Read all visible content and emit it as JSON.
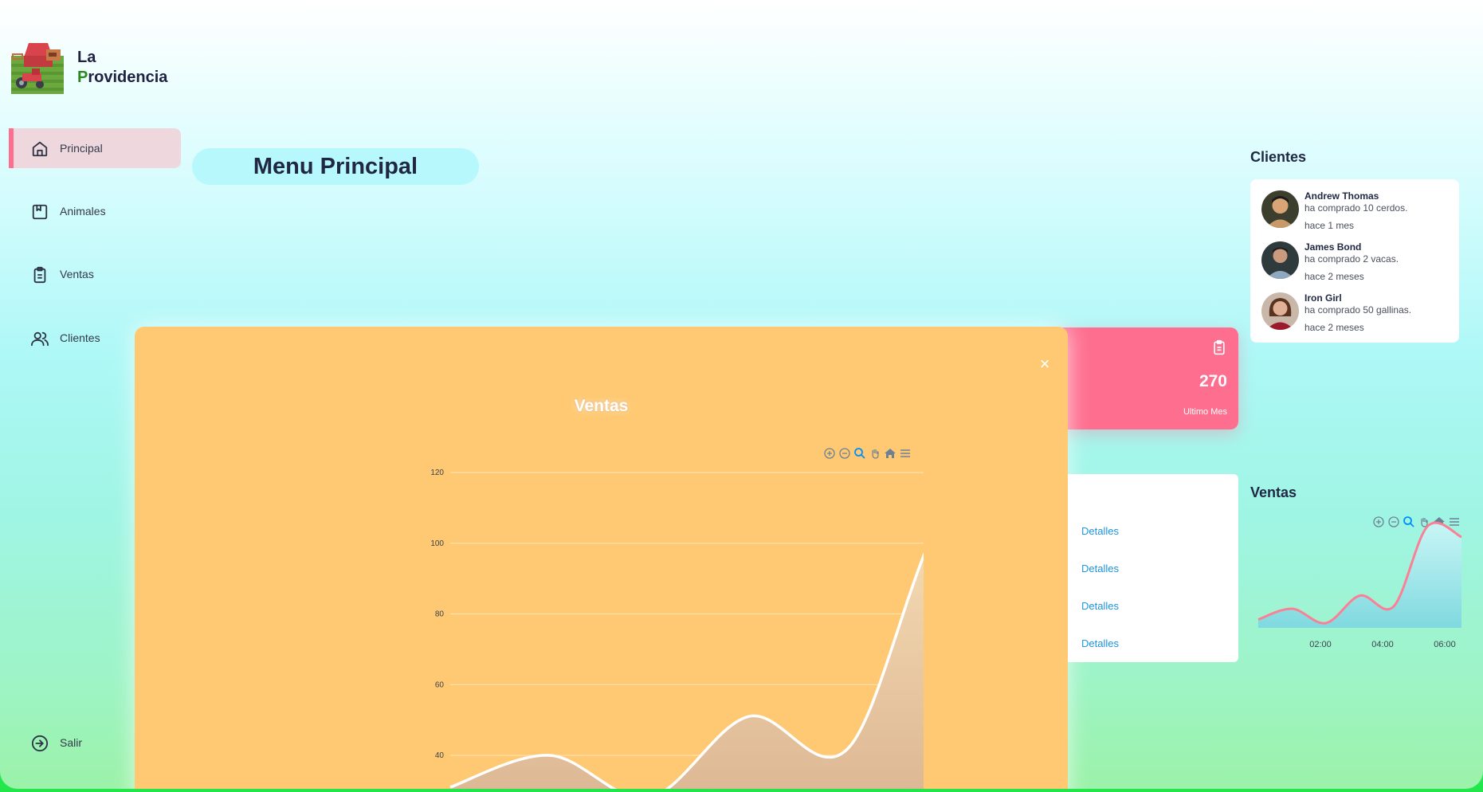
{
  "brand": {
    "line1": "La",
    "initial": "P",
    "rest": "rovidencia"
  },
  "sidebar": {
    "items": [
      {
        "label": "Principal",
        "icon": "home-icon",
        "active": true
      },
      {
        "label": "Animales",
        "icon": "bookmark-box-icon"
      },
      {
        "label": "Ventas",
        "icon": "clipboard-icon"
      },
      {
        "label": "Clientes",
        "icon": "users-icon"
      }
    ],
    "logout": {
      "label": "Salir",
      "icon": "logout-icon"
    }
  },
  "header": {
    "title": "Menu Principal"
  },
  "clients": {
    "title": "Clientes",
    "items": [
      {
        "name": "Andrew Thomas",
        "desc": "ha comprado 10 cerdos.",
        "time": "hace 1 mes"
      },
      {
        "name": "James Bond",
        "desc": "ha comprado 2 vacas.",
        "time": "hace 2 meses"
      },
      {
        "name": "Iron Girl",
        "desc": "ha comprado 50 gallinas.",
        "time": "hace 2 meses"
      }
    ]
  },
  "stat": {
    "value": "270",
    "label": "Ultimo Mes",
    "icon": "clipboard-icon",
    "color": "#fe6e8f"
  },
  "orders": {
    "links": [
      "Detalles",
      "Detalles",
      "Detalles",
      "Detalles"
    ]
  },
  "mini_sales": {
    "title": "Ventas",
    "x_ticks": [
      "02:00",
      "04:00",
      "06:00"
    ]
  },
  "modal": {
    "title": "Ventas",
    "close": "×"
  },
  "chart_data": [
    {
      "type": "area",
      "title": "Ventas",
      "y_ticks": [
        40,
        60,
        80,
        100,
        120
      ],
      "ylim": [
        24,
        120
      ],
      "x": [
        0,
        1,
        2,
        3,
        4,
        5,
        6
      ],
      "series": [
        {
          "values": [
            31,
            40,
            28,
            51,
            42,
            109,
            100
          ]
        }
      ],
      "grid": true,
      "line_color": "#ffffff"
    },
    {
      "type": "area",
      "title": "Ventas",
      "x_ticks": [
        "02:00",
        "04:00",
        "06:00"
      ],
      "x": [
        0,
        1,
        2,
        3,
        4,
        5,
        6
      ],
      "series": [
        {
          "values": [
            31,
            40,
            28,
            51,
            42,
            109,
            100
          ]
        }
      ],
      "line_color": "#fb8096"
    }
  ]
}
